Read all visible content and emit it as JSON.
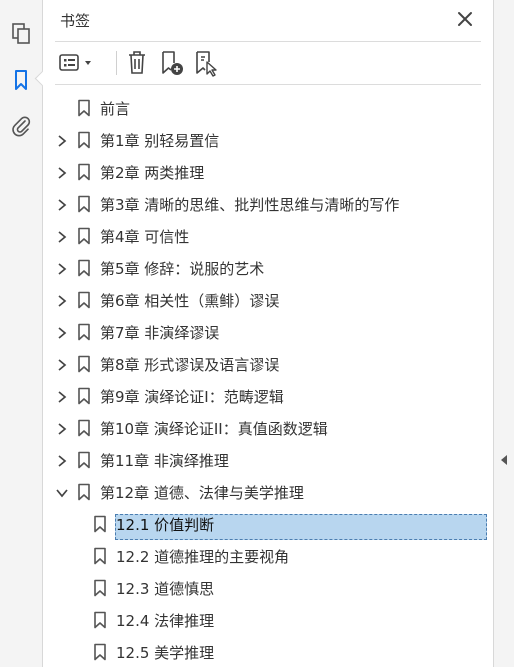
{
  "panel": {
    "title": "书签"
  },
  "icons": {
    "rail": [
      "pages-icon",
      "bookmark-icon",
      "attachment-icon"
    ],
    "toolbar": [
      "options-menu-icon",
      "delete-icon",
      "new-bookmark-icon",
      "bookmark-from-selection-icon"
    ]
  },
  "colors": {
    "accent": "#1473e6",
    "selection": "#b8d6ef"
  },
  "bookmarks": [
    {
      "label": "前言",
      "level": 0,
      "expander": "none"
    },
    {
      "label": "第1章 别轻易置信",
      "level": 0,
      "expander": "collapsed"
    },
    {
      "label": "第2章 两类推理",
      "level": 0,
      "expander": "collapsed"
    },
    {
      "label": "第3章 清晰的思维、批判性思维与清晰的写作",
      "level": 0,
      "expander": "collapsed"
    },
    {
      "label": "第4章 可信性",
      "level": 0,
      "expander": "collapsed"
    },
    {
      "label": "第5章 修辞：说服的艺术",
      "level": 0,
      "expander": "collapsed"
    },
    {
      "label": "第6章 相关性（熏鲱）谬误",
      "level": 0,
      "expander": "collapsed"
    },
    {
      "label": "第7章 非演绎谬误",
      "level": 0,
      "expander": "collapsed"
    },
    {
      "label": "第8章 形式谬误及语言谬误",
      "level": 0,
      "expander": "collapsed"
    },
    {
      "label": "第9章 演绎论证I：范畴逻辑",
      "level": 0,
      "expander": "collapsed"
    },
    {
      "label": "第10章 演绎论证II：真值函数逻辑",
      "level": 0,
      "expander": "collapsed"
    },
    {
      "label": "第11章 非演绎推理",
      "level": 0,
      "expander": "collapsed"
    },
    {
      "label": "第12章 道德、法律与美学推理",
      "level": 0,
      "expander": "expanded"
    },
    {
      "label": "12.1 价值判断",
      "level": 1,
      "expander": "none",
      "selected": true
    },
    {
      "label": "12.2 道德推理的主要视角",
      "level": 1,
      "expander": "none"
    },
    {
      "label": "12.3 道德慎思",
      "level": 1,
      "expander": "none"
    },
    {
      "label": "12.4 法律推理",
      "level": 1,
      "expander": "none"
    },
    {
      "label": "12.5 美学推理",
      "level": 1,
      "expander": "none"
    }
  ]
}
